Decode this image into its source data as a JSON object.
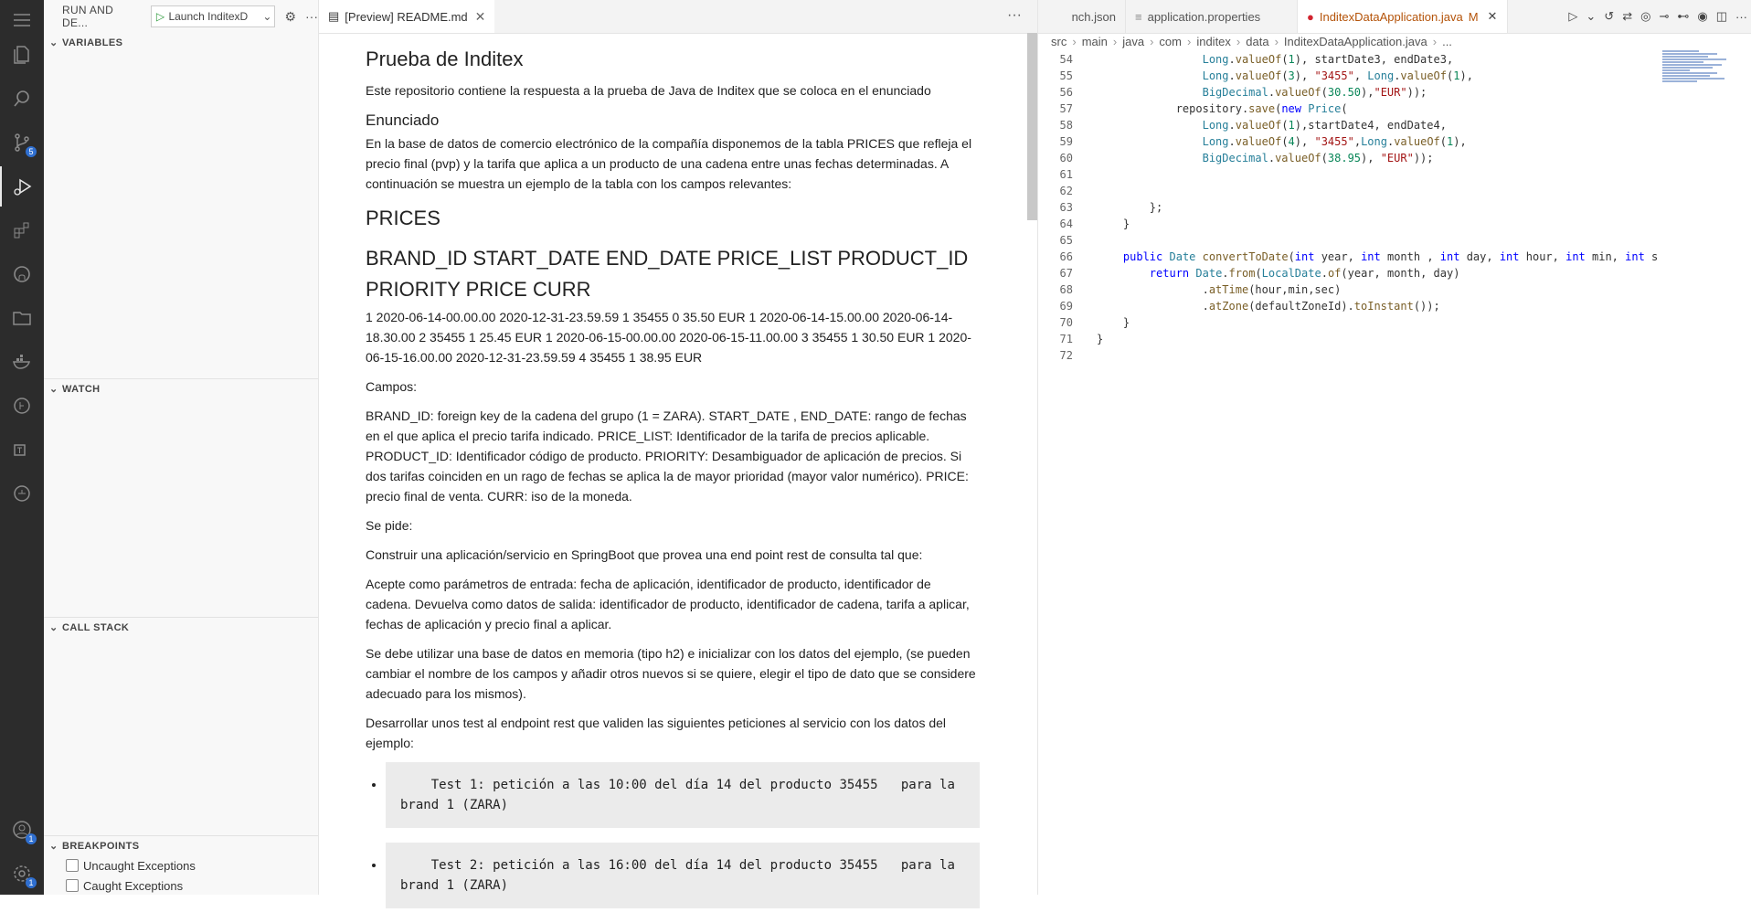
{
  "sidebar": {
    "title": "RUN AND DE...",
    "launch_config": "Launch InditexD",
    "sections": {
      "variables": "VARIABLES",
      "watch": "WATCH",
      "call_stack": "CALL STACK",
      "breakpoints": "BREAKPOINTS"
    },
    "breakpoint_items": [
      "Uncaught Exceptions",
      "Caught Exceptions"
    ]
  },
  "activity_bar": {
    "source_control_badge": "5",
    "accounts_badge": "1",
    "settings_badge": "1"
  },
  "preview": {
    "tab_label": "[Preview] README.md",
    "h1": "Prueba de Inditex",
    "intro": "Este repositorio contiene la respuesta a la prueba de Java de Inditex que se coloca en el enunciado",
    "h2": "Enunciado",
    "p1": "En la base de datos de comercio electrónico de la compañía disponemos de la tabla PRICES que refleja el precio final (pvp) y la tarifa que aplica a un producto de una cadena entre unas fechas determinadas. A continuación se muestra un ejemplo de la tabla con los campos relevantes:",
    "h_prices": "PRICES",
    "h_columns": "BRAND_ID START_DATE END_DATE PRICE_LIST PRODUCT_ID PRIORITY PRICE CURR",
    "rows": "1 2020-06-14-00.00.00 2020-12-31-23.59.59 1 35455 0 35.50 EUR 1 2020-06-14-15.00.00 2020-06-14-18.30.00 2 35455 1 25.45 EUR 1 2020-06-15-00.00.00 2020-06-15-11.00.00 3 35455 1 30.50 EUR 1 2020-06-15-16.00.00 2020-12-31-23.59.59 4 35455 1 38.95 EUR",
    "campos": "Campos:",
    "campos_desc": "BRAND_ID: foreign key de la cadena del grupo (1 = ZARA). START_DATE , END_DATE: rango de fechas en el que aplica el precio tarifa indicado. PRICE_LIST: Identificador de la tarifa de precios aplicable. PRODUCT_ID: Identificador código de producto. PRIORITY: Desambiguador de aplicación de precios. Si dos tarifas coinciden en un rago de fechas se aplica la de mayor prioridad (mayor valor numérico). PRICE: precio final de venta. CURR: iso de la moneda.",
    "se_pide": "Se pide:",
    "p_construir": "Construir una aplicación/servicio en SpringBoot que provea una end point rest de consulta tal que:",
    "p_acepte": "Acepte como parámetros de entrada: fecha de aplicación, identificador de producto, identificador de cadena. Devuelva como datos de salida: identificador de producto, identificador de cadena, tarifa a aplicar, fechas de aplicación y precio final a aplicar.",
    "p_bd": "Se debe utilizar una base de datos en memoria (tipo h2) e inicializar con los datos del ejemplo, (se pueden cambiar el nombre de los campos y añadir otros nuevos si se quiere, elegir el tipo de dato que se considere adecuado para los mismos).",
    "p_tests": "Desarrollar unos test al endpoint rest que validen las siguientes peticiones al servicio con los datos del ejemplo:",
    "test1": "    Test 1: petición a las 10:00 del día 14 del producto 35455   para la brand 1 (ZARA)",
    "test2": "    Test 2: petición a las 16:00 del día 14 del producto 35455   para la brand 1 (ZARA)"
  },
  "editor": {
    "tabs": [
      "nch.json",
      "application.properties",
      "InditexDataApplication.java"
    ],
    "active_tab_status": "M",
    "breadcrumb": [
      "src",
      "main",
      "java",
      "com",
      "inditex",
      "data",
      "InditexDataApplication.java",
      "..."
    ],
    "code_lines": [
      {
        "n": "54",
        "t": "                Long.valueOf(1), startDate3, endDate3,"
      },
      {
        "n": "55",
        "t": "                Long.valueOf(3), \"3455\", Long.valueOf(1),"
      },
      {
        "n": "56",
        "t": "                BigDecimal.valueOf(30.50),\"EUR\"));"
      },
      {
        "n": "57",
        "t": "            repository.save(new Price("
      },
      {
        "n": "58",
        "t": "                Long.valueOf(1),startDate4, endDate4,"
      },
      {
        "n": "59",
        "t": "                Long.valueOf(4), \"3455\",Long.valueOf(1),"
      },
      {
        "n": "60",
        "t": "                BigDecimal.valueOf(38.95), \"EUR\"));"
      },
      {
        "n": "61",
        "t": ""
      },
      {
        "n": "62",
        "t": ""
      },
      {
        "n": "63",
        "t": "        };"
      },
      {
        "n": "64",
        "t": "    }"
      },
      {
        "n": "65",
        "t": ""
      },
      {
        "n": "66",
        "t": "    public Date convertToDate(int year, int month , int day, int hour, int min, int s"
      },
      {
        "n": "67",
        "t": "        return Date.from(LocalDate.of(year, month, day)"
      },
      {
        "n": "68",
        "t": "                .atTime(hour,min,sec)"
      },
      {
        "n": "69",
        "t": "                .atZone(defaultZoneId).toInstant());"
      },
      {
        "n": "70",
        "t": "    }"
      },
      {
        "n": "71",
        "t": "}"
      },
      {
        "n": "72",
        "t": ""
      }
    ]
  }
}
